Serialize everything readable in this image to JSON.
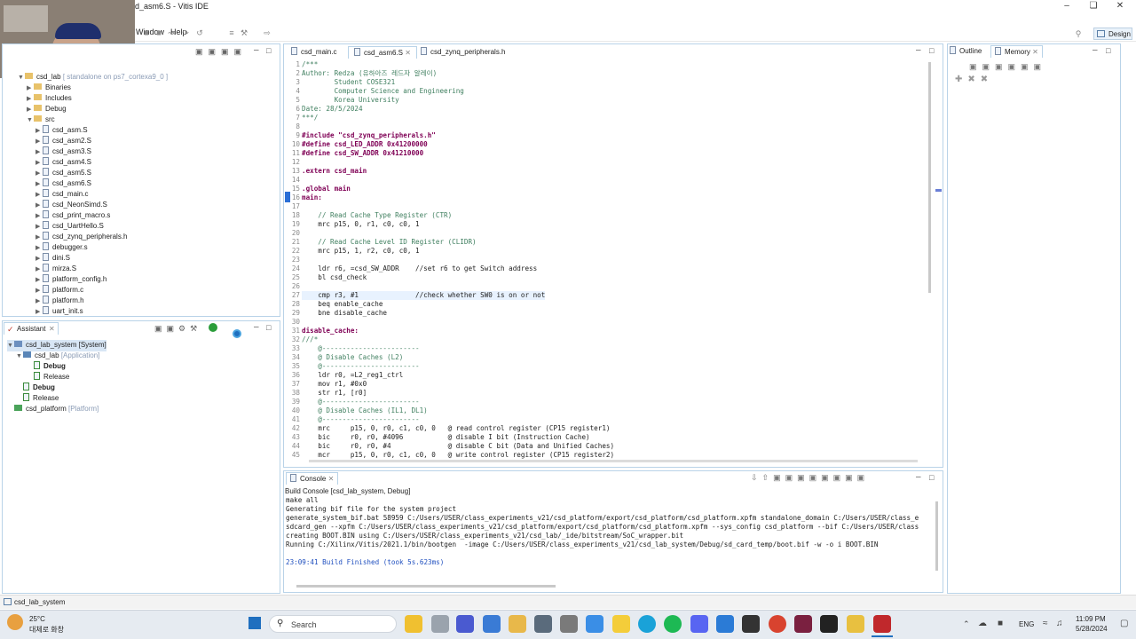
{
  "window": {
    "title": "d_asm6.S - Vitis IDE",
    "design_label": "Design"
  },
  "menu": {
    "window": "Window",
    "help": "Help"
  },
  "explorer": {
    "root": "csd_lab",
    "root_suffix": "[ standalone on ps7_cortexa9_0 ]",
    "items": [
      "Binaries",
      "Includes",
      "Debug",
      "src"
    ],
    "files": [
      "csd_asm.S",
      "csd_asm2.S",
      "csd_asm3.S",
      "csd_asm4.S",
      "csd_asm5.S",
      "csd_asm6.S",
      "csd_main.c",
      "csd_NeonSimd.S",
      "csd_print_macro.s",
      "csd_UartHello.S",
      "csd_zynq_peripherals.h",
      "debugger.s",
      "dini.S",
      "mirza.S",
      "platform_config.h",
      "platform.c",
      "platform.h",
      "uart_init.s"
    ]
  },
  "assistant": {
    "tab": "Assistant",
    "system": "csd_lab_system",
    "system_suffix": "[System]",
    "app": "csd_lab",
    "app_suffix": "[Application]",
    "debug": "Debug",
    "release": "Release",
    "debug2": "Debug",
    "release2": "Release",
    "platform": "csd_platform",
    "platform_suffix": "[Platform]"
  },
  "editor": {
    "tabs": [
      "csd_main.c",
      "csd_asm6.S",
      "csd_zynq_peripherals.h"
    ],
    "lines": [
      "/***",
      "Author: Redza (유하아즈 레드자 알레이)",
      "        Student COSE321",
      "        Computer Science and Engineering",
      "        Korea University",
      "Date: 28/5/2024",
      "***/",
      "",
      "#include \"csd_zynq_peripherals.h\"",
      "#define csd_LED_ADDR 0x41200000",
      "#define csd_SW_ADDR 0x41210000",
      "",
      ".extern csd_main",
      "",
      ".global main",
      "main:",
      "",
      "    // Read Cache Type Register (CTR)",
      "    mrc p15, 0, r1, c0, c0, 1",
      "",
      "    // Read Cache Level ID Register (CLIDR)",
      "    mrc p15, 1, r2, c0, c0, 1",
      "",
      "    ldr r6, =csd_SW_ADDR    //set r6 to get Switch address",
      "    bl csd_check",
      "",
      "    cmp r3, #1              //check whether SW0 is on or not",
      "    beq enable_cache",
      "    bne disable_cache",
      "",
      "disable_cache:",
      "///*",
      "    @------------------------",
      "    @ Disable Caches (L2)",
      "    @------------------------",
      "    ldr r0, =L2_reg1_ctrl",
      "    mov r1, #0x0",
      "    str r1, [r0]",
      "    @------------------------",
      "    @ Disable Caches (IL1, DL1)",
      "    @------------------------",
      "    mrc     p15, 0, r0, c1, c0, 0   @ read control register (CP15 register1)",
      "    bic     r0, r0, #4096           @ disable I bit (Instruction Cache)",
      "    bic     r0, r0, #4              @ disable C bit (Data and Unified Caches)",
      "    mcr     p15, 0, r0, c1, c0, 0   @ write control register (CP15 register2)"
    ]
  },
  "outline": {
    "tab": "Outline",
    "memory_tab": "Memory"
  },
  "console": {
    "tab": "Console",
    "header": "Build Console [csd_lab_system, Debug]",
    "lines": [
      "make all",
      "Generating bif file for the system project",
      "generate_system_bif.bat 58959 C:/Users/USER/class_experiments_v21/csd_platform/export/csd_platform/csd_platform.xpfm standalone_domain C:/Users/USER/class_e",
      "sdcard_gen --xpfm C:/Users/USER/class_experiments_v21/csd_platform/export/csd_platform/csd_platform.xpfm --sys_config csd_platform --bif C:/Users/USER/class",
      "creating BOOT.BIN using C:/Users/USER/class_experiments_v21/csd_lab/_ide/bitstream/SoC_wrapper.bit",
      "Running C:/Xilinx/Vitis/2021.1/bin/bootgen  -image C:/Users/USER/class_experiments_v21/csd_lab_system/Debug/sd_card_temp/boot.bif -w -o i BOOT.BIN",
      "",
      "23:09:41 Build Finished (took 5s.623ms)"
    ]
  },
  "status": {
    "selection": "csd_lab_system"
  },
  "taskbar": {
    "weather_temp": "25°C",
    "weather_desc": "대체로 화창",
    "search": "Search",
    "lang": "ENG",
    "time": "11:09 PM",
    "date": "5/28/2024"
  },
  "colors": {
    "accent": "#1f6fbf",
    "comment": "#3f7f5f",
    "keyword": "#7f0055",
    "string": "#2a00ff"
  }
}
